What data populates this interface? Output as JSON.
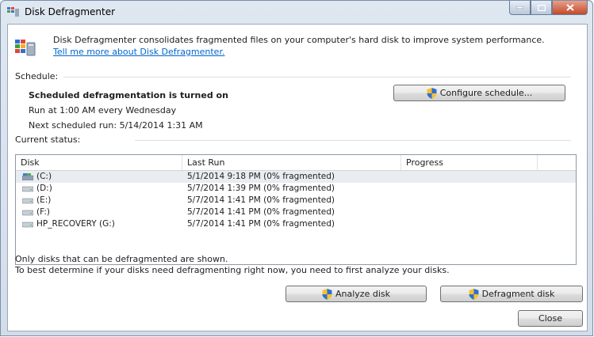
{
  "window": {
    "title": "Disk Defragmenter",
    "caption_buttons": [
      "minimize",
      "maximize",
      "close"
    ]
  },
  "intro": {
    "text": "Disk Defragmenter consolidates fragmented files on your computer's hard disk to improve system performance.",
    "link": "Tell me more about Disk Defragmenter."
  },
  "schedule": {
    "label": "Schedule:",
    "status": "Scheduled defragmentation is turned on",
    "run_at": "Run at 1:00 AM every Wednesday",
    "next_run": "Next scheduled run: 5/14/2014 1:31 AM",
    "configure_button": "Configure schedule..."
  },
  "current_status": {
    "label": "Current status:",
    "columns": [
      "Disk",
      "Last Run",
      "Progress"
    ],
    "rows": [
      {
        "disk": "(C:)",
        "last_run": "5/1/2014 9:18 PM (0% fragmented)",
        "progress": "",
        "icon": "system-drive-icon",
        "selected": true
      },
      {
        "disk": "(D:)",
        "last_run": "5/7/2014 1:39 PM (0% fragmented)",
        "progress": "",
        "icon": "drive-icon",
        "selected": false
      },
      {
        "disk": "(E:)",
        "last_run": "5/7/2014 1:41 PM (0% fragmented)",
        "progress": "",
        "icon": "drive-icon",
        "selected": false
      },
      {
        "disk": "(F:)",
        "last_run": "5/7/2014 1:41 PM (0% fragmented)",
        "progress": "",
        "icon": "drive-icon",
        "selected": false
      },
      {
        "disk": "HP_RECOVERY (G:)",
        "last_run": "5/7/2014 1:41 PM (0% fragmented)",
        "progress": "",
        "icon": "drive-icon",
        "selected": false
      }
    ]
  },
  "footer": {
    "note1": "Only disks that can be defragmented are shown.",
    "note2": "To best determine if your disks need defragmenting right now, you need to first analyze your disks.",
    "analyze_button": "Analyze disk",
    "defragment_button": "Defragment disk",
    "close_button": "Close"
  },
  "colors": {
    "link": "#0066cc",
    "selection": "#e9ecf0",
    "frame": "#d3dde9"
  }
}
